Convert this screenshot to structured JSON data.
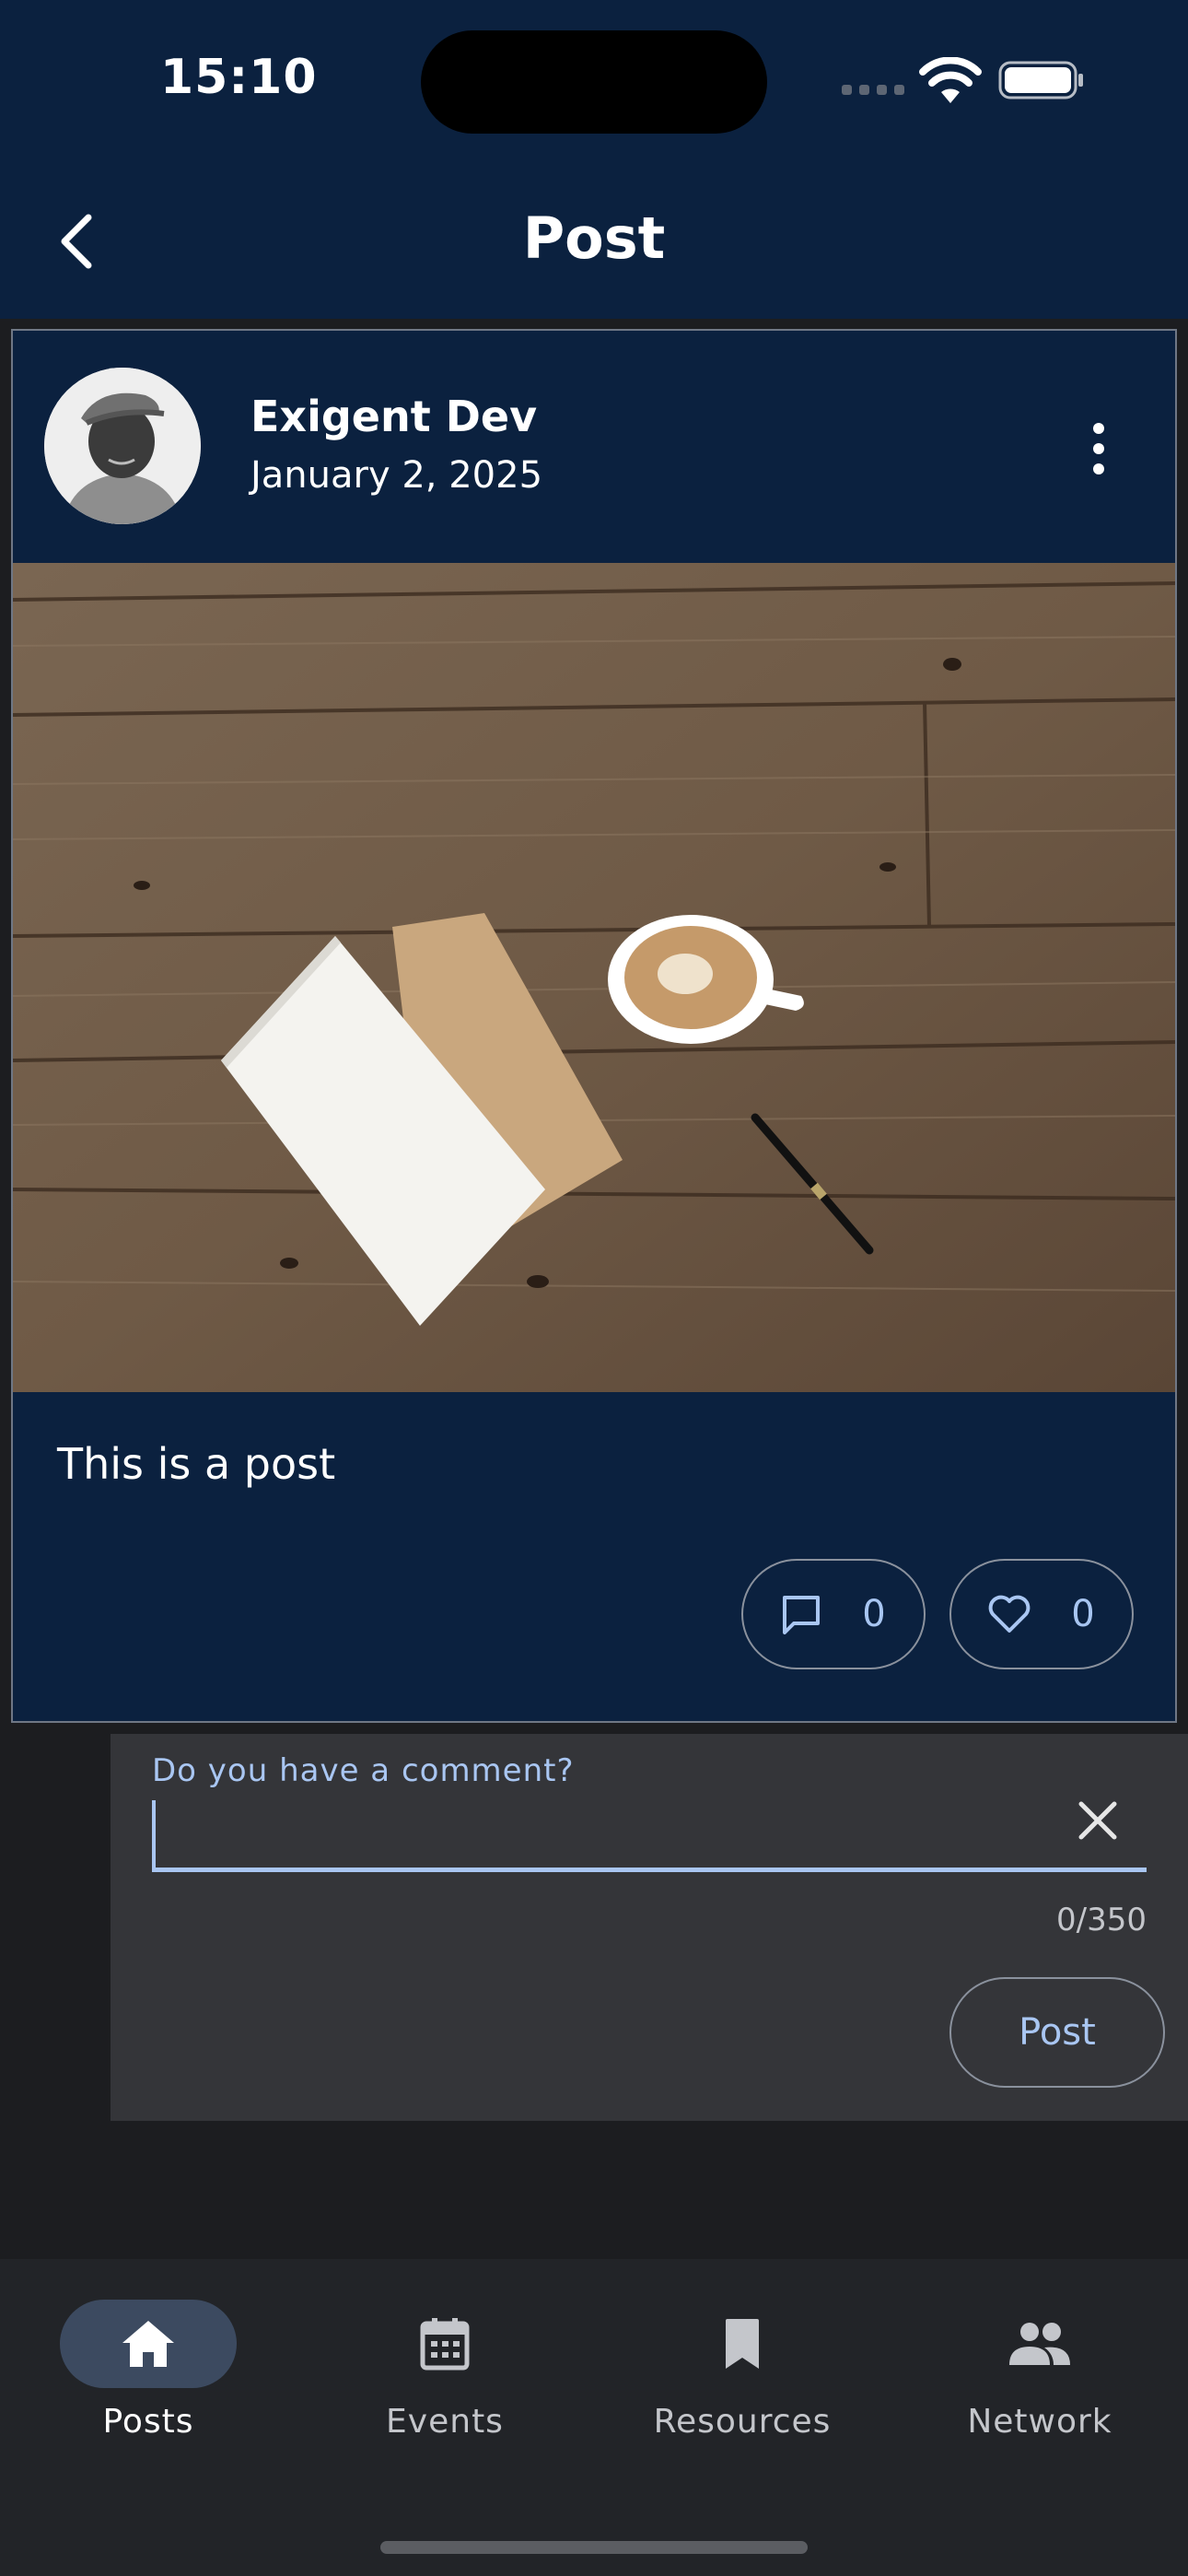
{
  "status_bar": {
    "time": "15:10"
  },
  "header": {
    "title": "Post"
  },
  "post": {
    "author": "Exigent Dev",
    "date": "January 2, 2025",
    "text": "This is a post",
    "comment_count": "0",
    "like_count": "0"
  },
  "comment": {
    "label": "Do you have a comment?",
    "value": "",
    "counter": "0/350",
    "post_label": "Post"
  },
  "bottom_nav": {
    "items": [
      {
        "label": "Posts",
        "icon": "home-icon",
        "active": true
      },
      {
        "label": "Events",
        "icon": "calendar-icon",
        "active": false
      },
      {
        "label": "Resources",
        "icon": "bookmark-icon",
        "active": false
      },
      {
        "label": "Network",
        "icon": "people-icon",
        "active": false
      }
    ]
  },
  "colors": {
    "header_bg": "#0b213f",
    "accent": "#a9c6f2",
    "page_bg": "#1c1d20",
    "comment_bg": "#343539",
    "nav_bg": "#222428",
    "nav_active_pill": "#3c4a60"
  }
}
